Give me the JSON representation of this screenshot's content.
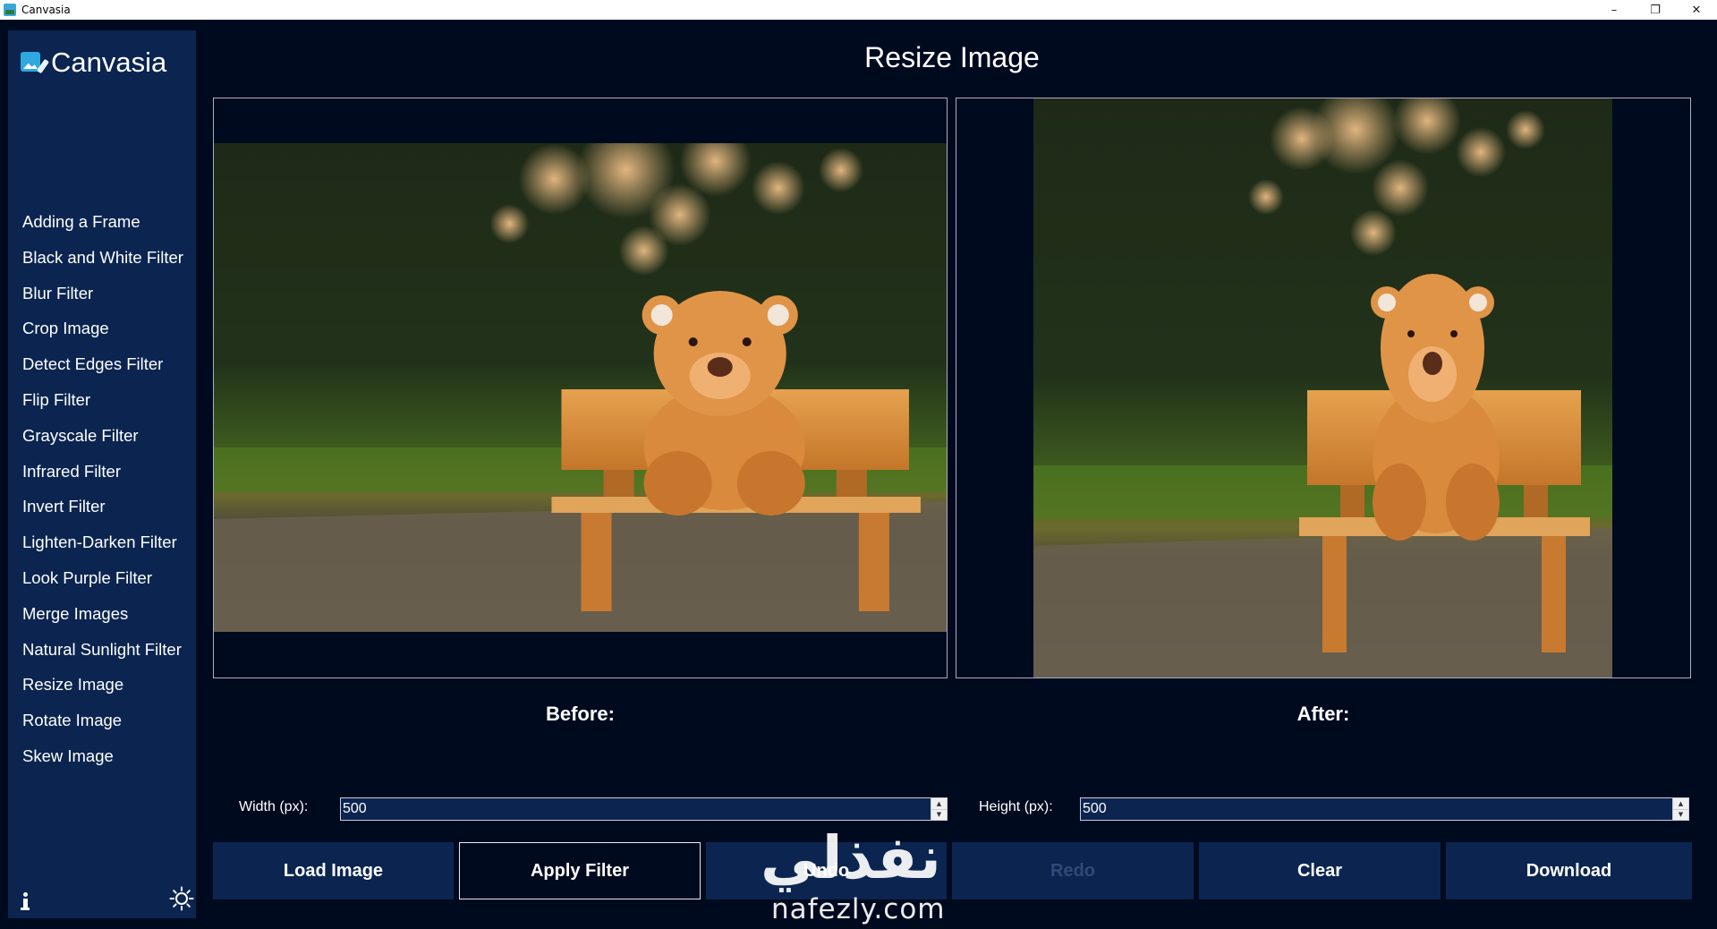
{
  "window": {
    "title": "Canvasia",
    "controls": {
      "minimize": "–",
      "restore": "❐",
      "close": "✕"
    }
  },
  "sidebar": {
    "brand": "Canvasia",
    "items": [
      {
        "label": "Adding a Frame"
      },
      {
        "label": "Black and White Filter"
      },
      {
        "label": "Blur Filter"
      },
      {
        "label": "Crop Image"
      },
      {
        "label": "Detect Edges Filter"
      },
      {
        "label": "Flip Filter"
      },
      {
        "label": "Grayscale Filter"
      },
      {
        "label": "Infrared Filter"
      },
      {
        "label": "Invert Filter"
      },
      {
        "label": "Lighten-Darken Filter"
      },
      {
        "label": "Look Purple Filter"
      },
      {
        "label": "Merge Images"
      },
      {
        "label": "Natural Sunlight Filter"
      },
      {
        "label": "Resize Image"
      },
      {
        "label": "Rotate Image"
      },
      {
        "label": "Skew Image"
      }
    ],
    "icons": {
      "info": "info-icon",
      "theme": "sun-icon"
    }
  },
  "main": {
    "title": "Resize Image",
    "before_label": "Before:",
    "after_label": "After:",
    "width_label": "Width (px):",
    "width_value": "500",
    "height_label": "Height (px):",
    "height_value": "500"
  },
  "buttons": {
    "load": "Load Image",
    "apply": "Apply Filter",
    "undo": "Undo",
    "redo": "Redo",
    "clear": "Clear",
    "download": "Download"
  },
  "watermark": {
    "arabic": "نفذلي",
    "latin": "nafezly.com"
  },
  "colors": {
    "background": "#000a1f",
    "sidebar": "#0b2550",
    "button": "#0b2550",
    "disabled_text": "#2d4a78"
  }
}
